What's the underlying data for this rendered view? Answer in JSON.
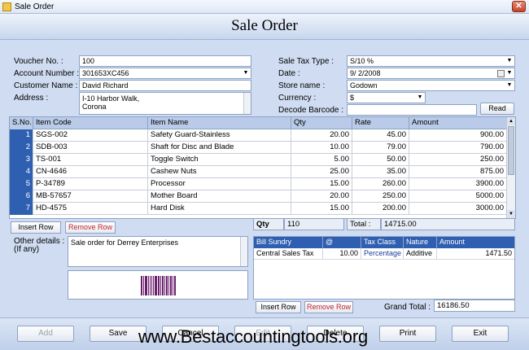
{
  "window": {
    "title": "Sale Order",
    "close_glyph": "✕"
  },
  "header": {
    "title": "Sale Order"
  },
  "form": {
    "voucher_label": "Voucher No. :",
    "voucher_value": "100",
    "account_label": "Account Number :",
    "account_value": "301653XC456",
    "customer_label": "Customer Name :",
    "customer_value": "David Richard",
    "address_label": "Address :",
    "address_line1": "I-10 Harbor Walk,",
    "address_line2": "Corona",
    "saletax_label": "Sale Tax Type :",
    "saletax_value": "S/10 %",
    "date_label": "Date :",
    "date_value": "9/  2/2008",
    "store_label": "Store name :",
    "store_value": "Godown",
    "currency_label": "Currency :",
    "currency_value": "$",
    "decode_label": "Decode Barcode :",
    "decode_value": "",
    "read_label": "Read"
  },
  "items_table": {
    "columns": [
      "S.No.",
      "Item Code",
      "Item Name",
      "Qty",
      "Rate",
      "Amount"
    ],
    "rows": [
      [
        "1",
        "SGS-002",
        "Safety Guard-Stainless",
        "20.00",
        "45.00",
        "900.00"
      ],
      [
        "2",
        "SDB-003",
        "Shaft for Disc and Blade",
        "10.00",
        "79.00",
        "790.00"
      ],
      [
        "3",
        "TS-001",
        "Toggle Switch",
        "5.00",
        "50.00",
        "250.00"
      ],
      [
        "4",
        "CN-4646",
        "Cashew Nuts",
        "25.00",
        "35.00",
        "875.00"
      ],
      [
        "5",
        "P-34789",
        "Processor",
        "15.00",
        "260.00",
        "3900.00"
      ],
      [
        "6",
        "MB-57657",
        "Mother Board",
        "20.00",
        "250.00",
        "5000.00"
      ],
      [
        "7",
        "HD-4575",
        "Hard Disk",
        "15.00",
        "200.00",
        "3000.00"
      ]
    ]
  },
  "item_actions": {
    "insert_row": "Insert Row",
    "remove_row": "Remove Row"
  },
  "totals": {
    "qty_label": "Qty",
    "qty_value": "110",
    "total_label": "Total :",
    "total_value": "14715.00"
  },
  "other": {
    "label_line1": "Other details :",
    "label_line2": "(If any)",
    "value": "Sale order for Derrey Enterprises"
  },
  "bill_table": {
    "columns": [
      "Bill Sundry",
      "@",
      "Tax Class",
      "Nature",
      "Amount"
    ],
    "rows": [
      [
        "Central Sales Tax",
        "10.00",
        "Percentage",
        "Additive",
        "1471.50"
      ]
    ]
  },
  "bill_actions": {
    "insert_row": "Insert Row",
    "remove_row": "Remove Row"
  },
  "grand_total": {
    "label": "Grand Total :",
    "value": "16186.50"
  },
  "footer": {
    "add": "Add",
    "save": "Save",
    "cancel": "Cancel",
    "edit": "Edit",
    "delete": "Delete",
    "print": "Print",
    "exit": "Exit"
  },
  "watermark": "www.Bestaccountingtools.org",
  "colors": {
    "background": "#cfdcf1",
    "selected_row_header": "#2f5fb0",
    "accent_red": "#c0262b",
    "barcode": "#6a1f6d"
  },
  "icons": [
    "app-icon",
    "close-icon",
    "dropdown-arrow-icon",
    "calendar-icon",
    "barcode-image"
  ]
}
